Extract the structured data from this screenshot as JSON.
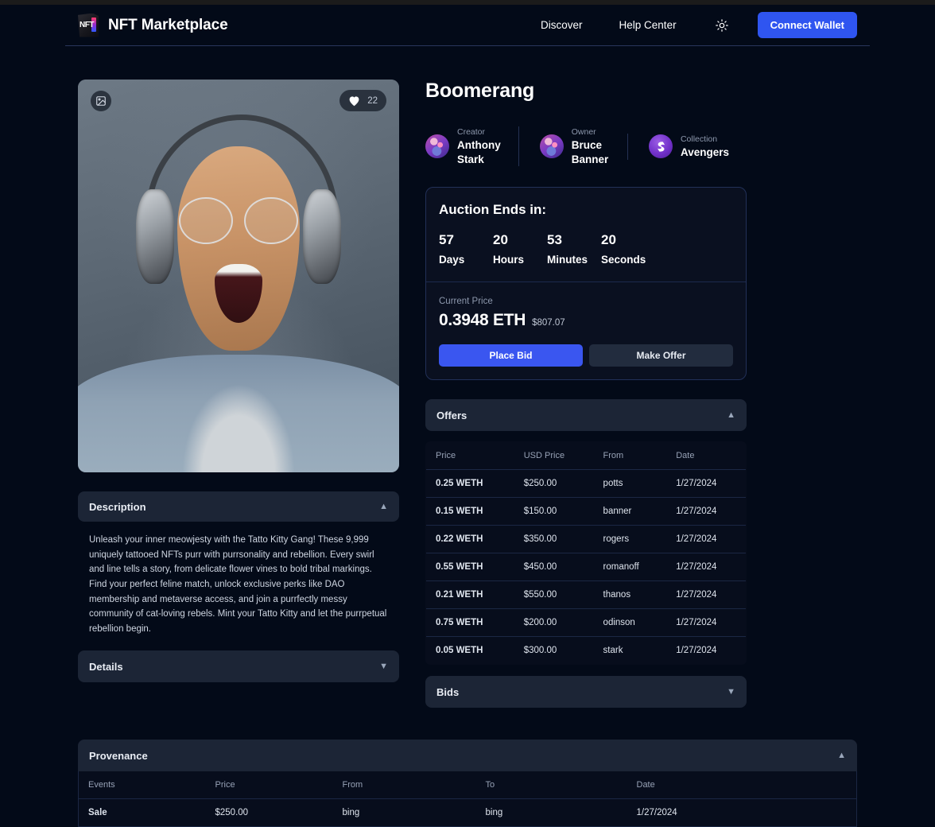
{
  "header": {
    "brand_title": "NFT Marketplace",
    "logo_text": "NFT",
    "nav": [
      {
        "label": "Discover"
      },
      {
        "label": "Help Center"
      }
    ],
    "theme_icon": "sun-icon",
    "connect_label": "Connect Wallet"
  },
  "nft": {
    "title": "Boomerang",
    "image_badge_icon": "image-icon",
    "like_icon": "heart-icon",
    "like_count": "22",
    "meta": [
      {
        "label": "Creator",
        "value": "Anthony Stark",
        "avatar": "creator-avatar"
      },
      {
        "label": "Owner",
        "value": "Bruce Banner",
        "avatar": "owner-avatar"
      },
      {
        "label": "Collection",
        "value": "Avengers",
        "avatar": "collection-avatar"
      }
    ]
  },
  "auction": {
    "heading": "Auction Ends in:",
    "countdown": [
      {
        "value": "57",
        "label": "Days"
      },
      {
        "value": "20",
        "label": "Hours"
      },
      {
        "value": "53",
        "label": "Minutes"
      },
      {
        "value": "20",
        "label": "Seconds"
      }
    ],
    "current_price_label": "Current Price",
    "price_eth": "0.3948 ETH",
    "price_usd": "$807.07",
    "place_bid_label": "Place Bid",
    "make_offer_label": "Make Offer"
  },
  "description": {
    "title": "Description",
    "body": "Unleash your inner meowjesty with the Tatto Kitty Gang! These 9,999 uniquely tattooed NFTs purr with purrsonality and rebellion. Every swirl and line tells a story, from delicate flower vines to bold tribal markings. Find your perfect feline match, unlock exclusive perks like DAO membership and metaverse access, and join a purrfectly messy community of cat-loving rebels. Mint your Tatto Kitty and let the purrpetual rebellion begin."
  },
  "details": {
    "title": "Details"
  },
  "offers": {
    "title": "Offers",
    "columns": [
      "Price",
      "USD Price",
      "From",
      "Date"
    ],
    "rows": [
      [
        "0.25 WETH",
        "$250.00",
        "potts",
        "1/27/2024"
      ],
      [
        "0.15 WETH",
        "$150.00",
        "banner",
        "1/27/2024"
      ],
      [
        "0.22 WETH",
        "$350.00",
        "rogers",
        "1/27/2024"
      ],
      [
        "0.55 WETH",
        "$450.00",
        "romanoff",
        "1/27/2024"
      ],
      [
        "0.21 WETH",
        "$550.00",
        "thanos",
        "1/27/2024"
      ],
      [
        "0.75 WETH",
        "$200.00",
        "odinson",
        "1/27/2024"
      ],
      [
        "0.05 WETH",
        "$300.00",
        "stark",
        "1/27/2024"
      ]
    ]
  },
  "bids": {
    "title": "Bids"
  },
  "provenance": {
    "title": "Provenance",
    "columns": [
      "Events",
      "Price",
      "From",
      "To",
      "Date"
    ],
    "rows": [
      [
        "Sale",
        "$250.00",
        "bing",
        "bing",
        "1/27/2024"
      ]
    ]
  },
  "colors": {
    "accent": "#2f55f0",
    "panel": "#1c2536",
    "background": "#030a18"
  }
}
